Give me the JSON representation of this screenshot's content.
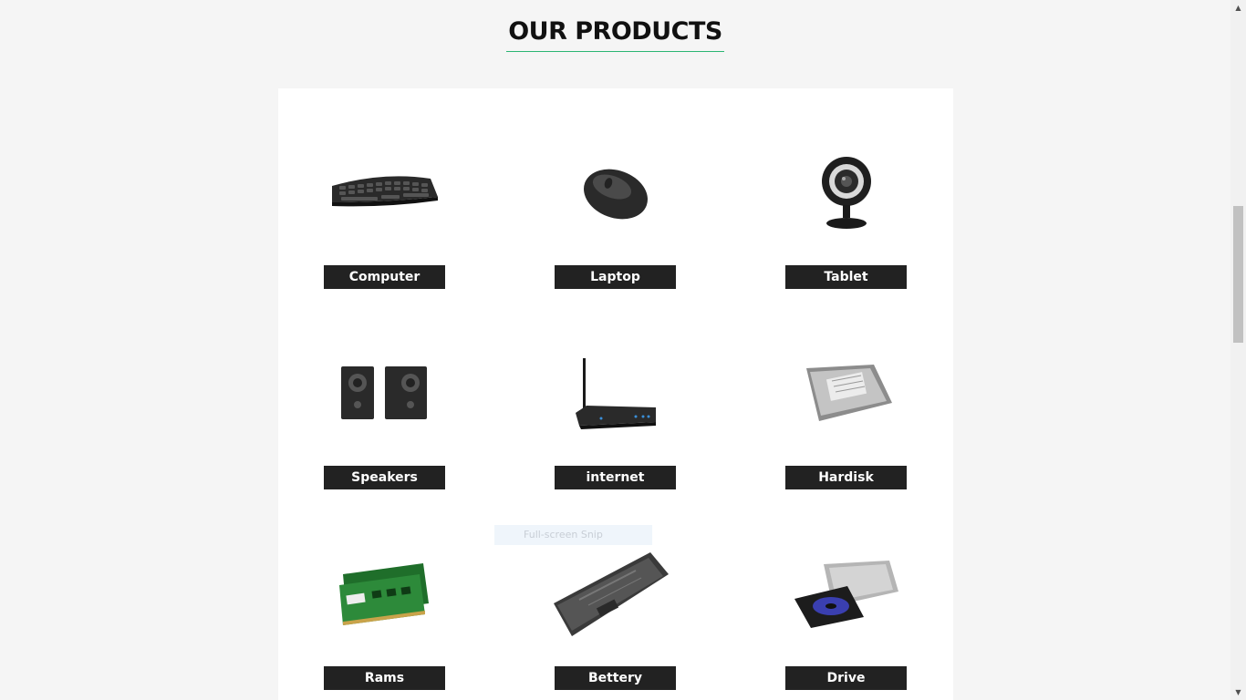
{
  "section": {
    "title": "OUR PRODUCTS"
  },
  "products": [
    {
      "label": "Computer",
      "icon": "keyboard-icon"
    },
    {
      "label": "Laptop",
      "icon": "mouse-icon"
    },
    {
      "label": "Tablet",
      "icon": "webcam-icon"
    },
    {
      "label": "Speakers",
      "icon": "speakers-icon"
    },
    {
      "label": "internet",
      "icon": "router-icon"
    },
    {
      "label": "Hardisk",
      "icon": "hard-disk-icon"
    },
    {
      "label": "Rams",
      "icon": "ram-icon"
    },
    {
      "label": "Bettery",
      "icon": "battery-icon"
    },
    {
      "label": "Drive",
      "icon": "optical-drive-icon"
    }
  ],
  "overlay": {
    "snip_text": "Full-screen Snip"
  },
  "colors": {
    "accent": "#2bb673",
    "label_bg": "#222222",
    "page_bg": "#f5f5f5"
  }
}
